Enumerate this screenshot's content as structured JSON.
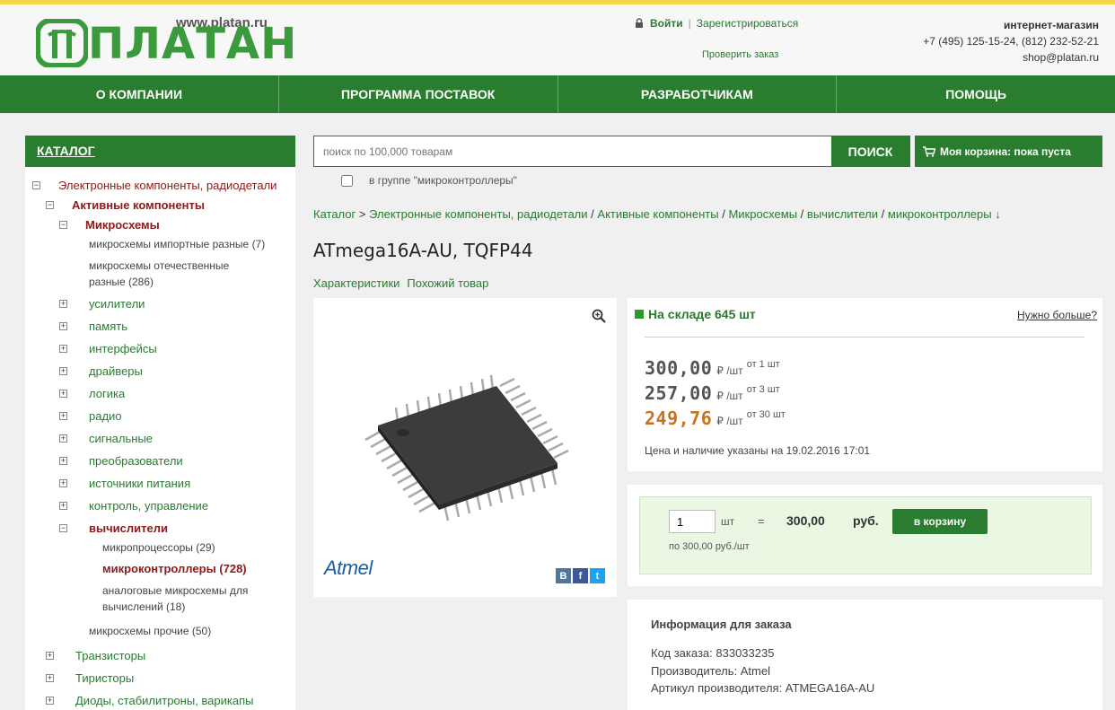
{
  "header": {
    "site": "www.platan.ru",
    "logo_text": "ПЛАТАН",
    "login": "Войти",
    "separator": "|",
    "register": "Зарегистрироваться",
    "check_order": "Проверить заказ",
    "shop_label": "интернет-магазин",
    "phones": "+7 (495) 125-15-24, (812) 232-52-21",
    "email": "shop@platan.ru"
  },
  "nav": [
    "О КОМПАНИИ",
    "ПРОГРАММА ПОСТАВОК",
    "РАЗРАБОТЧИКАМ",
    "ПОМОЩЬ"
  ],
  "catalog": {
    "title": "КАТАЛОГ",
    "items": [
      {
        "label": "Электронные компоненты, радиодетали",
        "toggle": "−"
      },
      {
        "label": "Активные компоненты",
        "toggle": "−"
      },
      {
        "label": "Микросхемы",
        "toggle": "−"
      },
      {
        "label": "микросхемы импортные разные (7)"
      },
      {
        "label": "микросхемы отечественные"
      },
      {
        "label": "разные (286)"
      },
      {
        "label": "усилители",
        "toggle": "+"
      },
      {
        "label": "память",
        "toggle": "+"
      },
      {
        "label": "интерфейсы",
        "toggle": "+"
      },
      {
        "label": "драйверы",
        "toggle": "+"
      },
      {
        "label": "логика",
        "toggle": "+"
      },
      {
        "label": "радио",
        "toggle": "+"
      },
      {
        "label": "сигнальные",
        "toggle": "+"
      },
      {
        "label": "преобразователи",
        "toggle": "+"
      },
      {
        "label": "источники питания",
        "toggle": "+"
      },
      {
        "label": "контроль, управление",
        "toggle": "+"
      },
      {
        "label": "вычислители",
        "toggle": "−"
      },
      {
        "label": "микропроцессоры (29)"
      },
      {
        "label": "микроконтроллеры (728)"
      },
      {
        "label": "аналоговые микросхемы для"
      },
      {
        "label": "вычислений (18)"
      },
      {
        "label": "микросхемы прочие (50)"
      },
      {
        "label": "Транзисторы",
        "toggle": "+"
      },
      {
        "label": "Тиристоры",
        "toggle": "+"
      },
      {
        "label": "Диоды, стабилитроны, варикапы",
        "toggle": "+"
      }
    ]
  },
  "search": {
    "placeholder": "поиск по 100,000 товарам",
    "button": "ПОИСК",
    "in_group": "в группе \"микроконтроллеры\""
  },
  "cart": {
    "label": "Моя корзина: пока пуста"
  },
  "breadcrumb": {
    "items": [
      "Каталог",
      "Электронные компоненты, радиодетали",
      "Активные компоненты",
      "Микросхемы",
      "вычислители",
      "микроконтроллеры ↓"
    ],
    "sep": "/",
    "first_sep": ">"
  },
  "product": {
    "title": "ATmega16A-AU, TQFP44",
    "tabs": [
      "Характеристики",
      "Похожий товар"
    ],
    "brand": "Atmel",
    "social": [
      "В",
      "f",
      "t"
    ],
    "stock": "На складе 645 шт",
    "need_more": "Нужно больше?",
    "prices": [
      {
        "value": "300,00",
        "unit": "₽ /шт",
        "from": "от 1 шт"
      },
      {
        "value": "257,00",
        "unit": "₽ /шт",
        "from": "от 3 шт"
      },
      {
        "value": "249,76",
        "unit": "₽ /шт",
        "from": "от 30 шт"
      }
    ],
    "price_note": "Цена и наличие указаны на 19.02.2016 17:01"
  },
  "order": {
    "qty": "1",
    "qty_unit": "шт",
    "eq": "=",
    "total": "300,00",
    "currency": "руб.",
    "button": "в корзину",
    "per_unit": "по 300,00 руб./шт"
  },
  "info": {
    "title": "Информация для заказа",
    "code": "Код заказа: 833033235",
    "maker": "Производитель: Atmel",
    "article": "Артикул производителя: ATMEGA16A-AU"
  },
  "colors": {
    "brand": "#2a7d2e",
    "accent_price": "#c8731e"
  }
}
